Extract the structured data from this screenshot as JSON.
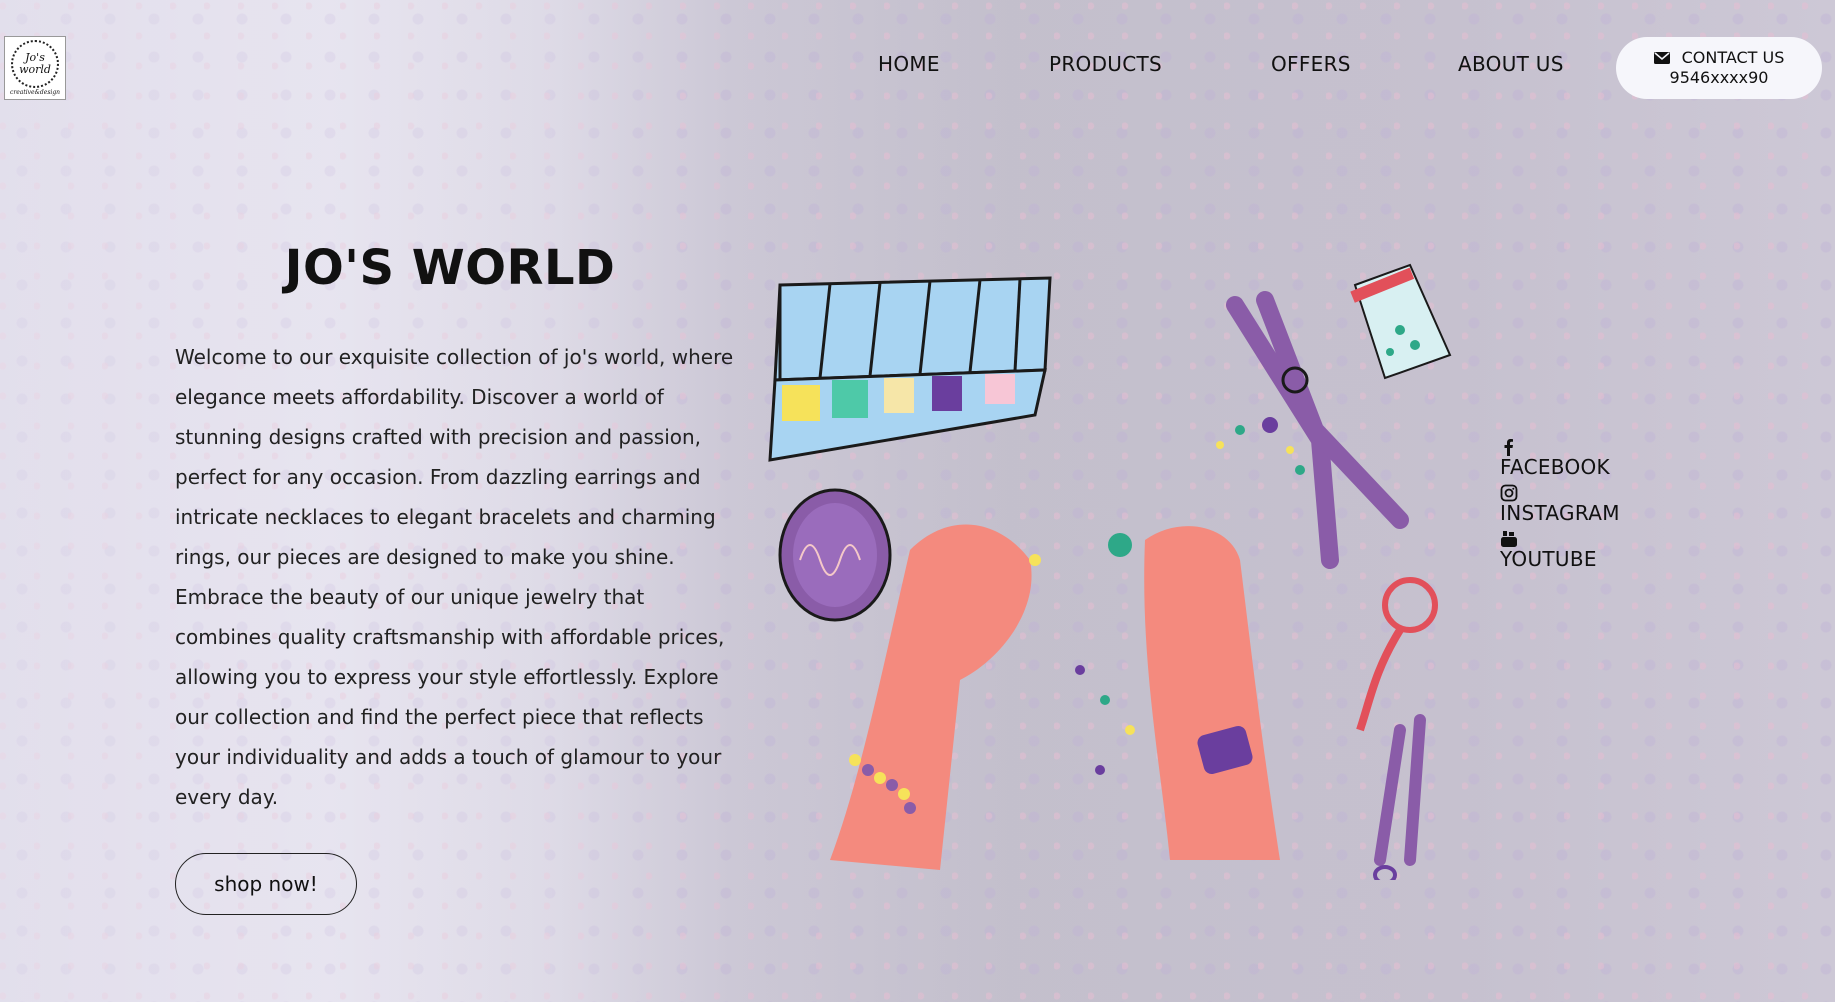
{
  "brand": {
    "logo_line1": "Jo's",
    "logo_line2": "world",
    "logo_tagline": "creative&design"
  },
  "nav": {
    "items": [
      {
        "label": "HOME"
      },
      {
        "label": "PRODUCTS"
      },
      {
        "label": "OFFERS"
      },
      {
        "label": "ABOUT US"
      }
    ]
  },
  "contact": {
    "label": "CONTACT US",
    "phone": "9546xxxx90",
    "icon": "envelope-icon"
  },
  "hero": {
    "title": "JO'S WORLD",
    "description": "Welcome to our exquisite collection of jo's world, where elegance meets affordability. Discover a world of stunning designs crafted with precision and passion, perfect for any occasion. From dazzling earrings and intricate necklaces to elegant bracelets and charming rings, our pieces are designed to make you shine. Embrace the beauty of our unique jewelry that combines quality craftsmanship with affordable prices, allowing you to express your style effortlessly. Explore our collection and find the perfect piece that reflects your individuality and adds a touch of glamour to your every day.",
    "cta": "shop now!"
  },
  "social": [
    {
      "label": "FACEBOOK",
      "icon": "facebook-icon"
    },
    {
      "label": "INSTAGRAM",
      "icon": "instagram-icon"
    },
    {
      "label": "YOUTUBE",
      "icon": "youtube-icon"
    }
  ],
  "colors": {
    "skin": "#f48a7e",
    "purple": "#8a5ca8",
    "light_blue": "#a8d4f2",
    "contact_bg": "#f6f6fb"
  }
}
